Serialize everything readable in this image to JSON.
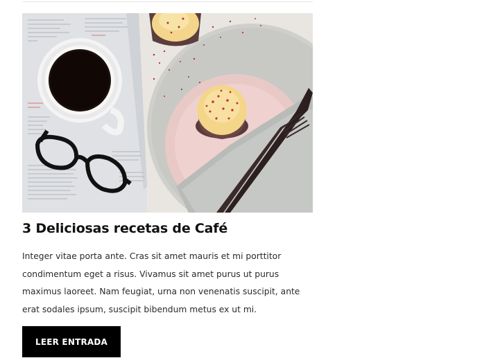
{
  "post": {
    "title": "3 Deliciosas recetas de Café",
    "excerpt": "Integer vitae porta ante. Cras sit amet mauris et mi porttitor condimentum eget a risus. Vivamus sit amet purus ut purus maximus laoreet. Nam feugiat, urna non venenatis suscipit, ante erat sodales ipsum, suscipit bibendum metus ex ut mi.",
    "button_label": "LEER ENTRADA",
    "image_alt": "coffee-cup-cupcake-glasses-photo"
  }
}
